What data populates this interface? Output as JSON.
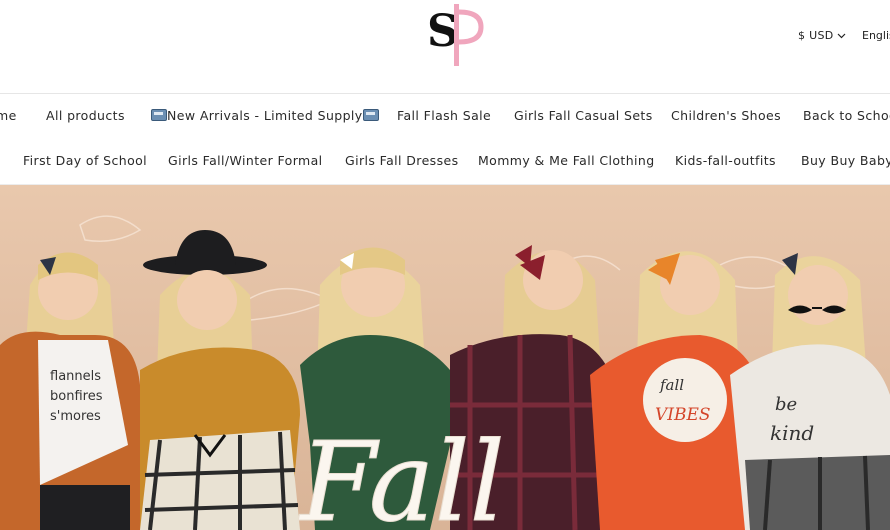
{
  "header": {
    "logo_text": "SP",
    "currency": "$ USD",
    "language": "Englis"
  },
  "nav": {
    "row1": [
      "me",
      "All products",
      "New Arrivals - Limited Supply",
      "Fall Flash Sale",
      "Girls Fall Casual Sets",
      "Children's Shoes",
      "Back to School"
    ],
    "row2": [
      "First Day of School",
      "Girls Fall/Winter Formal",
      "Girls Fall Dresses",
      "Mommy & Me Fall Clothing",
      "Kids-fall-outfits",
      "Buy Buy Baby"
    ]
  },
  "hero": {
    "headline": "Fall",
    "shirt_texts": {
      "girl1": [
        "flannels",
        "bonfires",
        "s'mores"
      ],
      "girl5": [
        "fall",
        "VIBES"
      ],
      "girl6": [
        "be",
        "kind"
      ]
    }
  },
  "colors": {
    "accent_pink": "#f0a6bd",
    "hero_bg": "#e2bfa3"
  },
  "icons": [
    "chevron-down-icon",
    "bus-icon"
  ]
}
